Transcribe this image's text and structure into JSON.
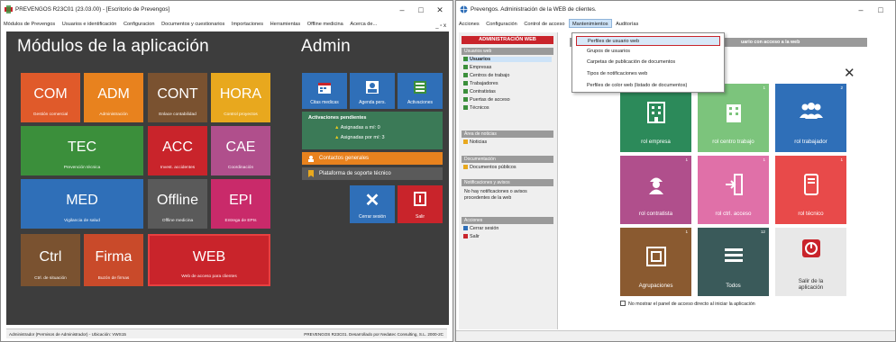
{
  "left_window": {
    "title": "PREVENGOS R23C01 (23.03.00) - [Escritorio de Prevengos]",
    "menu": [
      "Módulos de Prevengos",
      "Usuarios e identificación",
      "Configuracion",
      "Documentos y cuestionarios",
      "Importaciones",
      "Herramientas",
      "Offline medicina",
      "Acerca de..."
    ],
    "menu_sys": "_ ▫ x",
    "desk_title": "Módulos de la aplicación",
    "admin_title": "Admin",
    "tiles": [
      {
        "big": "COM",
        "small": "Gestión comercial",
        "color": "#e05a2a"
      },
      {
        "big": "ADM",
        "small": "Administración",
        "color": "#e8821e"
      },
      {
        "big": "CONT",
        "small": "Enlace contabilidad",
        "color": "#7a5230"
      },
      {
        "big": "HORA",
        "small": "Control proyectos",
        "color": "#e8a81e"
      },
      {
        "big": "TEC",
        "small": "Prevención técnica",
        "color": "#3b8f3b"
      },
      {
        "big": "ACC",
        "small": "Invest. accidentes",
        "color": "#c9242b"
      },
      {
        "big": "CAE",
        "small": "Coordinación",
        "color": "#b04f8c"
      },
      {
        "big": "MED",
        "small": "Vigilancia de salud",
        "color": "#2f6fb8"
      },
      {
        "big": "Offline",
        "small": "Offline medicina",
        "color": "#5a5a5a"
      },
      {
        "big": "EPI",
        "small": "Entrega de EPIs",
        "color": "#c92a6a"
      },
      {
        "big": "Ctrl",
        "small": "Ctrl. de situación",
        "color": "#7a5230"
      },
      {
        "big": "Firma",
        "small": "Buzón de firmas",
        "color": "#c94a2a"
      },
      {
        "big": "WEB",
        "small": "Web de acceso para clientes",
        "color": "#c9242b"
      }
    ],
    "admin": {
      "citas": "Citas medicas",
      "agenda": "Agenda pers.",
      "activaciones": "Activaciones",
      "pending_title": "Activaciones pendientes",
      "pending_1": "Asignadas a mí: 0",
      "pending_2": "Asignadas por mí: 3",
      "contactos": "Contactos generales",
      "plataforma": "Plataforma de soporte técnico",
      "cerrar": "Cerrar sesión",
      "salir": "Salir"
    },
    "status_left": "Administrador  (Permisos de Administrador)  -  Ubicación: VWS15",
    "status_right": "PREVENGOS R23C01. Desarrollado por Nedatec Consulting, S.L. 2000-2C"
  },
  "right_window": {
    "title": "Prevengos. Administración de la WEB de clientes.",
    "menu": [
      "Acciones",
      "Configuración",
      "Control de acceso",
      "Mantenimientos",
      "Auditorías"
    ],
    "active_menu_index": 3,
    "dropdown": [
      "Perfiles de usuario web",
      "Grupos de usuarios",
      "Carpetas de publicación de documentos",
      "Tipos de notificaciones web",
      "Perfiles de color web (listado de documentos)"
    ],
    "sidebar": {
      "header": "ADMINISTRACIÓN WEB",
      "sec_usuarios": "Usuarios web",
      "items": [
        "Usuarios",
        "Empresas",
        "Centros de trabajo",
        "Trabajadores",
        "Contratistas",
        "Puertas de acceso",
        "Técnicos"
      ],
      "sec_noticias": "Área de noticias",
      "noticias": "Noticias",
      "sec_doc": "Documentación",
      "doc": "Documentos públicos",
      "sec_notif": "Notificaciones y avisos",
      "notif_text": "No hay notificaciones o avisos procedentes de la web",
      "sec_acciones": "Acciones",
      "cerrar": "Cerrar sesión",
      "salir": "Salir"
    },
    "graybar_text": "uario con acceso a la web",
    "close_glyph": "✕",
    "tiles": [
      {
        "label": "rol empresa",
        "num": "1",
        "color": "#2c8a5a"
      },
      {
        "label": "rol centro trabajo",
        "num": "1",
        "color": "#7cc47c"
      },
      {
        "label": "rol trabajador",
        "num": "2",
        "color": "#2f6fb8"
      },
      {
        "label": "rol contratista",
        "num": "1",
        "color": "#b04f8c"
      },
      {
        "label": "rol ctrl. acceso",
        "num": "1",
        "color": "#e070a8"
      },
      {
        "label": "rol técnico",
        "num": "1",
        "color": "#e84a4a"
      },
      {
        "label": "Agrupaciones",
        "num": "1",
        "color": "#8a5a30"
      },
      {
        "label": "Todos",
        "num": "12",
        "color": "#3a5a5a"
      },
      {
        "label": "Salir de la aplicación",
        "num": "",
        "color": "#e8e8e8"
      }
    ],
    "checkbox_label": "No mostrar el panel de acceso directo al iniciar la aplicación"
  }
}
